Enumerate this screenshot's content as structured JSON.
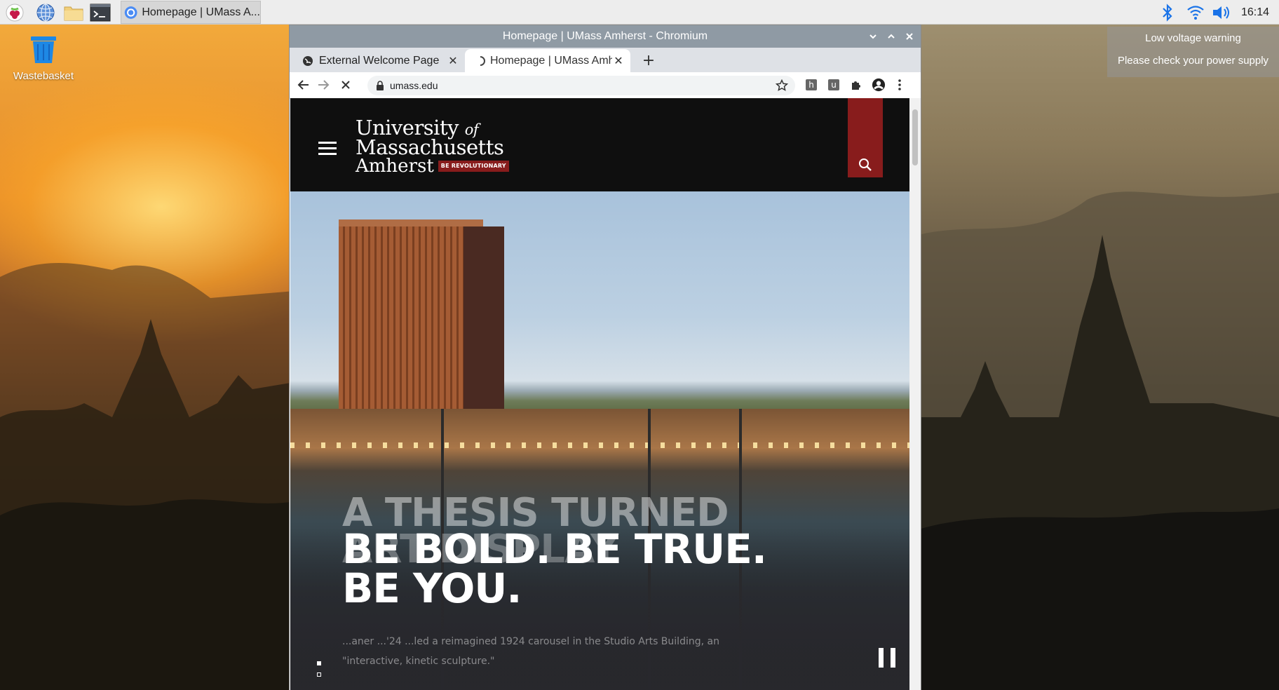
{
  "taskbar": {
    "task_title": "Homepage | UMass A...",
    "clock": "16:14",
    "icons": [
      "raspberry-menu-icon",
      "web-browser-icon",
      "file-manager-icon",
      "terminal-icon",
      "bluetooth-icon",
      "wifi-icon",
      "volume-icon"
    ]
  },
  "desktop": {
    "wastebasket_label": "Wastebasket"
  },
  "notification": {
    "line1": "Low voltage warning",
    "line2": "Please check your power supply"
  },
  "browser": {
    "window_title": "Homepage | UMass Amherst - Chromium",
    "tabs": [
      {
        "label": "External Welcome Page",
        "active": false
      },
      {
        "label": "Homepage | UMass Amh",
        "active": true
      }
    ],
    "url": "umass.edu"
  },
  "site": {
    "logo_line1": "University",
    "logo_of": "of",
    "logo_line2": "Massachusetts",
    "logo_line3": "Amherst",
    "logo_badge": "BE REVOLUTIONARY",
    "slide_title_behind_1": "A THESIS TURNED",
    "slide_title_behind_2": "ART DISPLAY",
    "slide_description": "...aner ...'24 ...led a reimagined 1924 carousel in the Studio Arts Building, an \"interactive, kinetic sculpture.\"",
    "hero_line1": "BE BOLD. BE TRUE.",
    "hero_line2": "BE YOU."
  },
  "colors": {
    "umass_maroon": "#881c1c",
    "header_black": "#0f0f0f",
    "taskbar": "#ededed",
    "titlebar": "#8f9aa4",
    "tray_blue": "#1a73e8"
  }
}
